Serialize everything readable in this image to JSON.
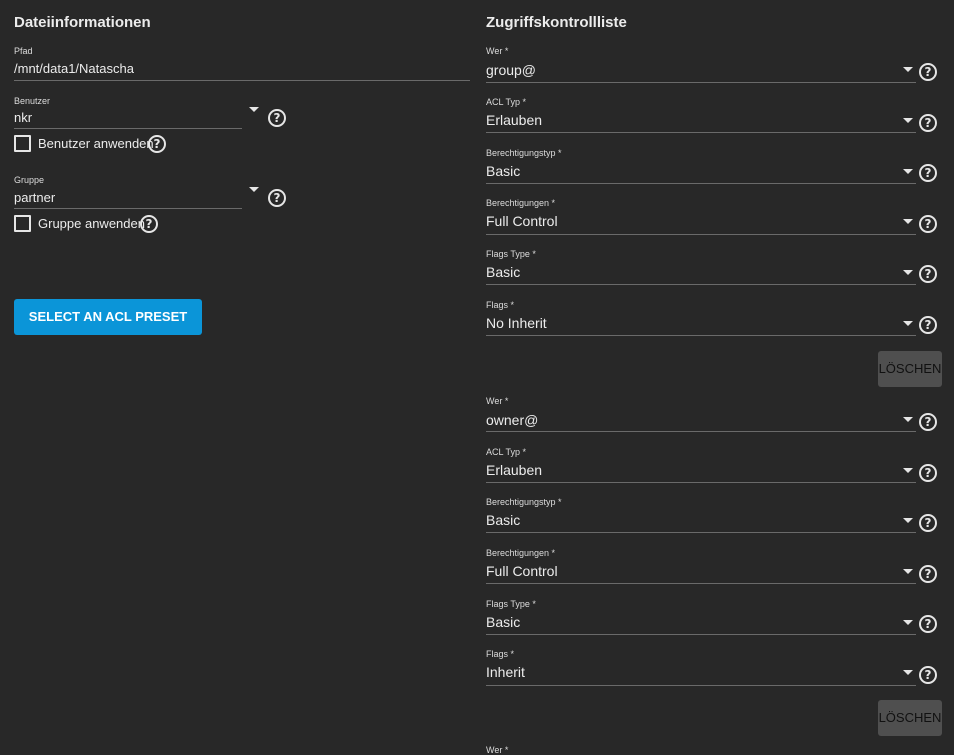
{
  "file_info": {
    "title": "Dateiinformationen",
    "path_label": "Pfad",
    "path_value": "/mnt/data1/Natascha",
    "user_label": "Benutzer",
    "user_value": "nkr",
    "apply_user_label": "Benutzer anwenden",
    "group_label": "Gruppe",
    "group_value": "partner",
    "apply_group_label": "Gruppe anwenden",
    "preset_button": "SELECT AN ACL PRESET"
  },
  "acl": {
    "title": "Zugriffskontrollliste",
    "delete_label": "LÖSCHEN",
    "entries": [
      {
        "who_label": "Wer *",
        "who_value": "group@",
        "type_label": "ACL Typ *",
        "type_value": "Erlauben",
        "perm_type_label": "Berechtigungstyp *",
        "perm_type_value": "Basic",
        "perms_label": "Berechtigungen *",
        "perms_value": "Full Control",
        "flags_type_label": "Flags Type *",
        "flags_type_value": "Basic",
        "flags_label": "Flags *",
        "flags_value": "No Inherit"
      },
      {
        "who_label": "Wer *",
        "who_value": "owner@",
        "type_label": "ACL Typ *",
        "type_value": "Erlauben",
        "perm_type_label": "Berechtigungstyp *",
        "perm_type_value": "Basic",
        "perms_label": "Berechtigungen *",
        "perms_value": "Full Control",
        "flags_type_label": "Flags Type *",
        "flags_type_value": "Basic",
        "flags_label": "Flags *",
        "flags_value": "Inherit"
      },
      {
        "who_label": "Wer *"
      }
    ]
  },
  "icons": {
    "help": "help-circle-icon",
    "dropdown": "caret-down-icon",
    "checkbox": "checkbox-unchecked"
  },
  "colors": {
    "background": "#282828",
    "primary_button": "#0b95d8",
    "delete_button": "#4f4f4f"
  }
}
